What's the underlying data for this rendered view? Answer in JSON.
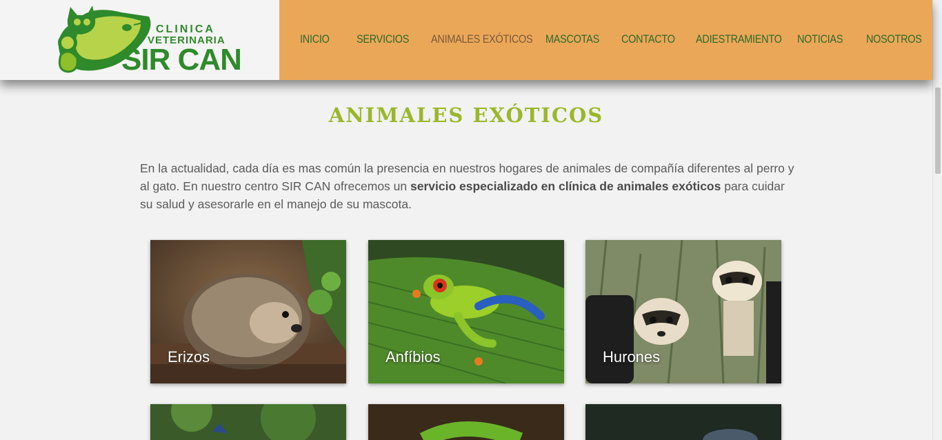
{
  "logo": {
    "line1": "CLINICA",
    "line2": "VETERINARIA",
    "line3": "SIR CAN"
  },
  "nav": {
    "items": [
      {
        "label": "INICIO",
        "active": false
      },
      {
        "label": "SERVICIOS",
        "active": false
      },
      {
        "label": "ANIMALES EXÓTICOS",
        "active": true
      },
      {
        "label": "MASCOTAS",
        "active": false
      },
      {
        "label": "CONTACTO",
        "active": false
      },
      {
        "label": "ADIESTRAMIENTO",
        "active": false
      },
      {
        "label": "NOTICIAS",
        "active": false
      },
      {
        "label": "NOSOTROS",
        "active": false
      }
    ]
  },
  "page": {
    "title": "ANIMALES EXÓTICOS",
    "intro_part1": "En la actualidad, cada día es mas común la presencia en nuestros hogares de animales de compañía diferentes al perro y al gato. En nuestro centro SIR CAN ofrecemos un ",
    "intro_bold": "servicio especializado en clínica de animales exóticos",
    "intro_part2": " para cuidar su salud y asesorarle en el manejo de su mascota."
  },
  "cards": [
    {
      "label": "Erizos",
      "image": "hedgehog-photo"
    },
    {
      "label": "Anfíbios",
      "image": "frog-photo"
    },
    {
      "label": "Hurones",
      "image": "ferret-photo"
    },
    {
      "label": "",
      "image": "bird-photo"
    },
    {
      "label": "",
      "image": "snake-photo"
    },
    {
      "label": "",
      "image": "dark-animal-photo"
    }
  ],
  "colors": {
    "nav_bg": "#eba758",
    "nav_text": "#2c6a2a",
    "title": "#9ab72a",
    "logo_green": "#2e8a2a"
  }
}
